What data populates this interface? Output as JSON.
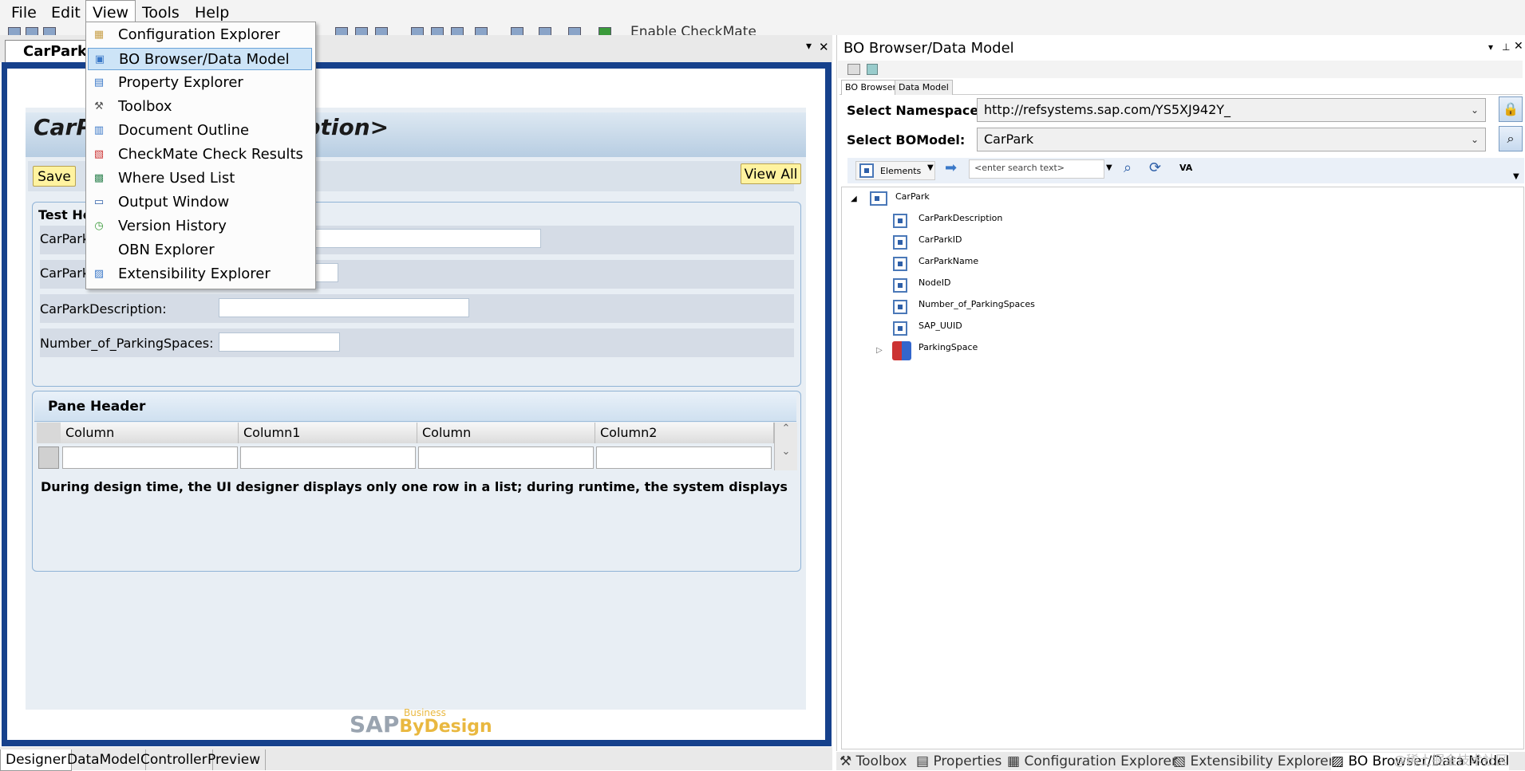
{
  "menubar": {
    "items": [
      "File",
      "Edit",
      "View",
      "Tools",
      "Help"
    ]
  },
  "toolbar": {
    "enable_checkmate": "Enable CheckMate"
  },
  "document": {
    "tab_label": "CarPark",
    "title": "CarPark <CarParkDescription>",
    "title_visible_left": "CarP",
    "title_visible_right": "escription>",
    "save_label": "Save",
    "view_all_label": "View All",
    "section_header": "Test He",
    "fields": [
      "CarPark",
      "CarPark",
      "CarParkDescription:",
      "Number_of_ParkingSpaces:"
    ],
    "pane_header": "Pane Header",
    "columns": [
      "Column",
      "Column1",
      "Column",
      "Column2"
    ],
    "note": "During design time, the UI designer displays only one row in a list; during runtime, the system displays the number of ro",
    "logo_sap": "SAP",
    "logo_business": "Business",
    "logo_bydesign": "ByDesign"
  },
  "view_menu": {
    "items": [
      {
        "label": "Configuration Explorer",
        "icon": "config-explorer-icon"
      },
      {
        "label": "BO Browser/Data Model",
        "icon": "bo-browser-icon"
      },
      {
        "label": "Property Explorer",
        "icon": "property-icon"
      },
      {
        "label": "Toolbox",
        "icon": "toolbox-icon"
      },
      {
        "label": "Document Outline",
        "icon": "outline-icon"
      },
      {
        "label": "CheckMate Check Results",
        "icon": "checkmate-icon"
      },
      {
        "label": "Where Used List",
        "icon": "where-used-icon"
      },
      {
        "label": "Output Window",
        "icon": "output-window-icon"
      },
      {
        "label": "Version History",
        "icon": "version-history-icon"
      },
      {
        "label": "OBN Explorer",
        "icon": ""
      },
      {
        "label": "Extensibility Explorer",
        "icon": "extensibility-icon"
      }
    ],
    "highlighted_index": 1
  },
  "bottom_tabs": [
    "Designer",
    "DataModel",
    "Controller",
    "Preview"
  ],
  "right_panel": {
    "title": "BO Browser/Data Model",
    "tabs": [
      "BO Browser",
      "Data Model"
    ],
    "namespace_label": "Select Namespace:",
    "namespace_value": "http://refsystems.sap.com/YS5XJ942Y_",
    "bomodel_label": "Select BOModel:",
    "bomodel_value": "CarPark",
    "elements_label": "Elements",
    "search_placeholder": "<enter search text>",
    "va_label": "VA",
    "tree_root": "CarPark",
    "tree_children": [
      "CarParkDescription",
      "CarParkID",
      "CarParkName",
      "NodeID",
      "Number_of_ParkingSpaces",
      "SAP_UUID"
    ],
    "tree_collapsed": "ParkingSpace"
  },
  "right_bottom_tabs": [
    "Toolbox",
    "Properties",
    "Configuration Explorer",
    "Extensibility Explorer",
    "BO Browser/Data Model"
  ],
  "watermark": "@稀土掘金技术社区"
}
